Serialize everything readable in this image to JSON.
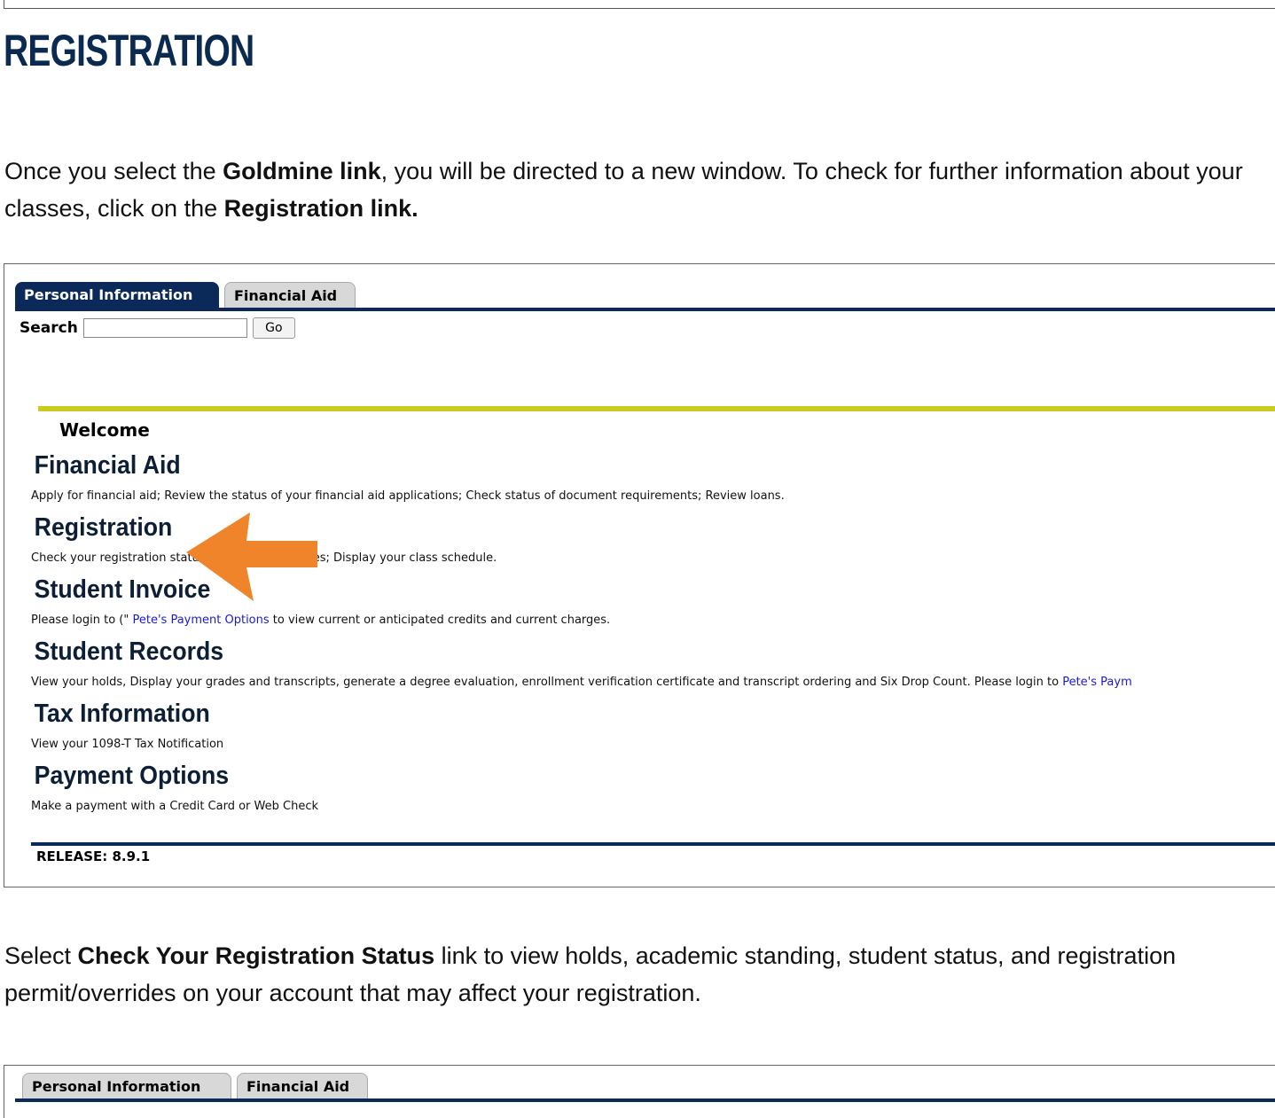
{
  "page": {
    "heading": "REGISTRATION",
    "intro1": {
      "part1": "Once you select the ",
      "bold1": "Goldmine link",
      "part2": ", you will be directed to a new window. To check for further information about your classes, click on the ",
      "bold2": "Registration link."
    },
    "intro2": {
      "part1": "Select ",
      "bold1": "Check Your Registration Status",
      "part2": " link to view holds, academic standing, student status, and registration permit/overrides on your account that may affect your registration."
    }
  },
  "screenshot1": {
    "tabs": [
      {
        "label": "Personal Information",
        "active": true
      },
      {
        "label": "Financial Aid",
        "active": false
      }
    ],
    "search": {
      "label": "Search",
      "value": "",
      "button": "Go"
    },
    "welcome": "Welcome",
    "menu": [
      {
        "title": "Financial Aid",
        "desc": "Apply for financial aid; Review the status of your financial aid applications; Check status of document requirements; Review loans."
      },
      {
        "title": "Registration",
        "desc": "Check your registration status; Add or drop classes; Display your class schedule."
      },
      {
        "title": "Student Invoice",
        "desc_pre": "Please login to (\" ",
        "desc_link": "Pete's Payment Options",
        "desc_post": " to view current or anticipated credits and current charges."
      },
      {
        "title": "Student Records",
        "desc_pre": "View your holds, Display your grades and transcripts, generate a degree evaluation, enrollment verification certificate and transcript ordering and Six Drop Count. Please login to ",
        "desc_link": "Pete's Paym"
      },
      {
        "title": "Tax Information",
        "desc": "View your 1098-T Tax Notification"
      },
      {
        "title": "Payment Options",
        "desc": "Make a payment with a Credit Card or Web Check"
      }
    ],
    "release": "RELEASE: 8.9.1",
    "arrow_color": "#f0842a"
  },
  "screenshot2": {
    "tabs": [
      {
        "label": "Personal Information",
        "active": false
      },
      {
        "label": "Financial Aid",
        "active": false
      }
    ]
  },
  "colors": {
    "navy": "#0b2a5a",
    "yellow": "#c8cc1e",
    "link": "#1a1ad6",
    "heading": "#0b2a4f"
  }
}
